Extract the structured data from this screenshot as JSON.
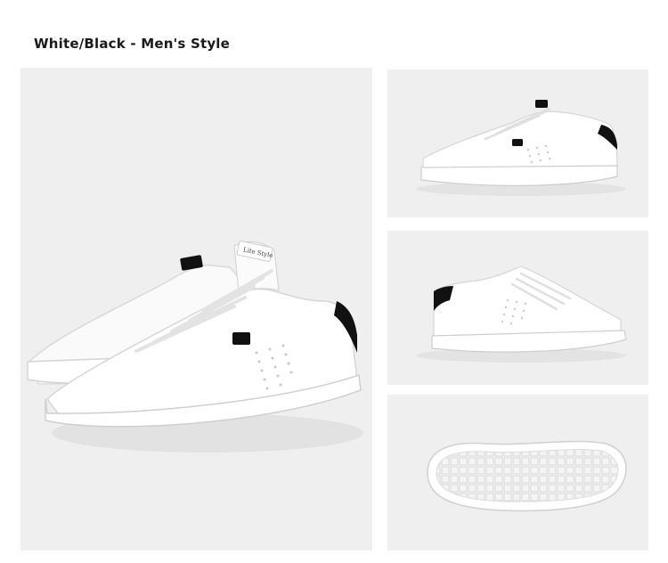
{
  "header": {
    "title": "White/Black - Men's Style"
  },
  "main_image": {
    "tongue_label": "Lite Style"
  },
  "colors": {
    "panel_bg": "#efefef",
    "shoe_white": "#ffffff",
    "accent_black": "#111111"
  }
}
